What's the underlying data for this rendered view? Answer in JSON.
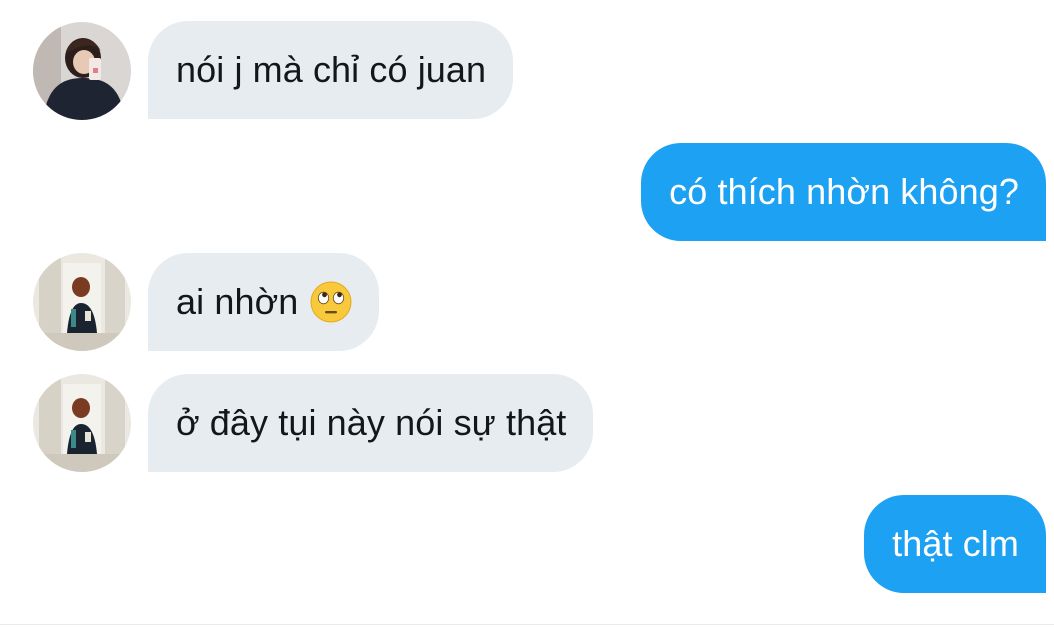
{
  "conversation": {
    "messages": [
      {
        "direction": "incoming",
        "text": "nói j mà chỉ có juan",
        "avatar": "user-avatar-1",
        "emoji": ""
      },
      {
        "direction": "outgoing",
        "text": "có thích nhờn không?",
        "emoji": ""
      },
      {
        "direction": "incoming",
        "text": "ai nhờn",
        "avatar": "user-avatar-2",
        "emoji": "face-with-rolling-eyes"
      },
      {
        "direction": "incoming",
        "text": "ở đây tụi này nói sự thật",
        "avatar": "user-avatar-2",
        "emoji": ""
      },
      {
        "direction": "outgoing",
        "text": "thật clm",
        "emoji": ""
      }
    ]
  },
  "colors": {
    "incoming_bubble": "#e6ecf0",
    "outgoing_bubble": "#1da1f2",
    "incoming_text": "#14171a",
    "outgoing_text": "#ffffff"
  }
}
